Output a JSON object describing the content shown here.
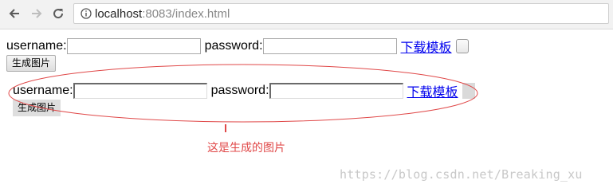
{
  "browser": {
    "url_host": "localhost",
    "url_rest": ":8083/index.html",
    "icons": {
      "back": "arrow-left-icon",
      "forward": "arrow-right-icon",
      "reload": "reload-icon",
      "info": "info-icon"
    }
  },
  "form": {
    "username_label": "username:",
    "password_label": "password:",
    "download_link": "下载模板",
    "generate_button": "生成图片",
    "username_value": "",
    "password_value": ""
  },
  "image_preview": {
    "username_label": "username:",
    "password_label": "password:",
    "download_link": "下载模板",
    "generate_button": "生成图片"
  },
  "annotation": {
    "caption": "这是生成的图片",
    "color": "#e04848"
  },
  "watermark": {
    "text": "https://blog.csdn.net/Breaking_xu"
  }
}
